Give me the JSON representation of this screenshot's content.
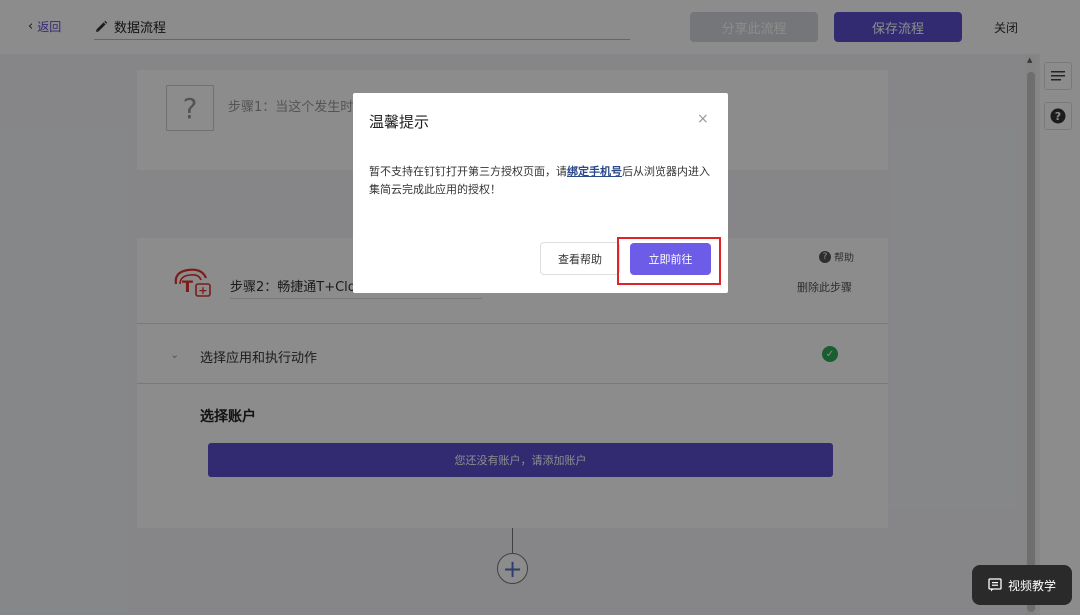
{
  "topbar": {
    "back_label": "返回",
    "title": "数据流程",
    "share_label": "分享此流程",
    "save_label": "保存流程",
    "close_label": "关闭"
  },
  "step1": {
    "icon_char": "?",
    "label": "步骤1：当这个发生时"
  },
  "step2": {
    "label": "步骤2：畅捷通T+Cloud",
    "help_label": "帮助",
    "delete_label": "删除此步骤",
    "app_section_label": "选择应用和执行动作",
    "account_title": "选择账户",
    "account_button": "您还没有账户，请添加账户"
  },
  "add_step_symbol": "+",
  "video_tutorial_label": "视频教学",
  "dialog": {
    "title": "温馨提示",
    "close_symbol": "×",
    "body_before": "暂不支持在钉钉打开第三方授权页面，请",
    "body_link": "绑定手机号",
    "body_after": "后从浏览器内进入集简云完成此应用的授权！",
    "help_button": "查看帮助",
    "go_button": "立即前往"
  },
  "colors": {
    "accent": "#5b4fcf",
    "go_button": "#6c5ce7",
    "success": "#2faa5a",
    "highlight": "#e0232a"
  }
}
